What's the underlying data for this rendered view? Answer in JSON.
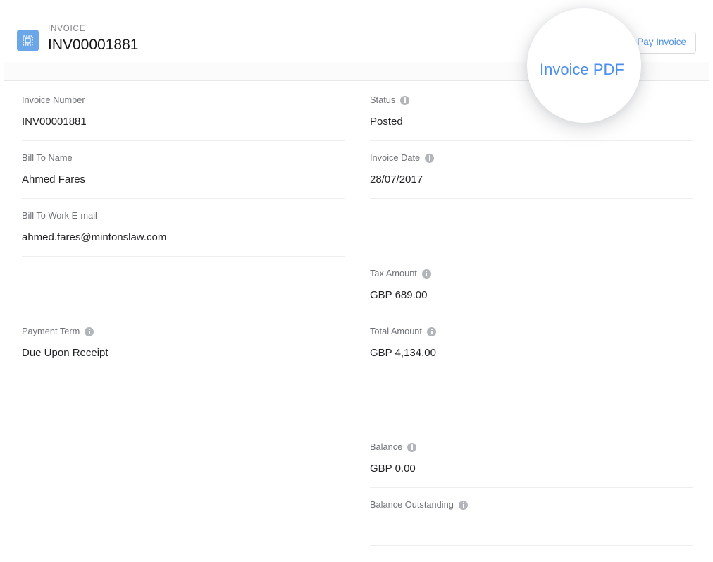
{
  "header": {
    "record_type": "INVOICE",
    "record_name": "INV00001881",
    "icon": "invoice-stamp-icon",
    "actions": [
      {
        "label": "Pay Invoice",
        "name": "pay-invoice-button"
      }
    ]
  },
  "overlay": {
    "kind": "spotlight-magnifier",
    "menu_item_label": "Invoice PDF"
  },
  "colors": {
    "accent_link": "#4a8ef0",
    "icon_background": "#6aa6e8",
    "label_text": "#6e7277",
    "value_text": "#1f2124",
    "divider": "#eceef0",
    "page_border": "#d4d6d9",
    "band_background": "#fbfbfc",
    "info_icon": "#b2b5b9"
  },
  "detail": {
    "left_column": [
      {
        "label": "Invoice Number",
        "value": "INV00001881",
        "has_info": false,
        "name": "field-invoice-number"
      },
      {
        "label": "Bill To Name",
        "value": "Ahmed Fares",
        "has_info": false,
        "name": "field-bill-to-name"
      },
      {
        "label": "Bill To Work E-mail",
        "value": "ahmed.fares@mintonslaw.com",
        "has_info": false,
        "name": "field-bill-to-work-email"
      },
      {
        "label": "Payment Term",
        "value": "Due Upon Receipt",
        "has_info": true,
        "name": "field-payment-term"
      }
    ],
    "right_column": [
      {
        "label": "Status",
        "value": "Posted",
        "has_info": true,
        "name": "field-status"
      },
      {
        "label": "Invoice Date",
        "value": "28/07/2017",
        "has_info": true,
        "name": "field-invoice-date"
      },
      {
        "label": "Tax Amount",
        "value": "GBP 689.00",
        "has_info": true,
        "name": "field-tax-amount"
      },
      {
        "label": "Total Amount",
        "value": "GBP 4,134.00",
        "has_info": true,
        "name": "field-total-amount"
      },
      {
        "label": "Balance",
        "value": "GBP 0.00",
        "has_info": true,
        "name": "field-balance"
      },
      {
        "label": "Balance Outstanding",
        "value": "",
        "has_info": true,
        "name": "field-balance-outstanding"
      }
    ]
  }
}
